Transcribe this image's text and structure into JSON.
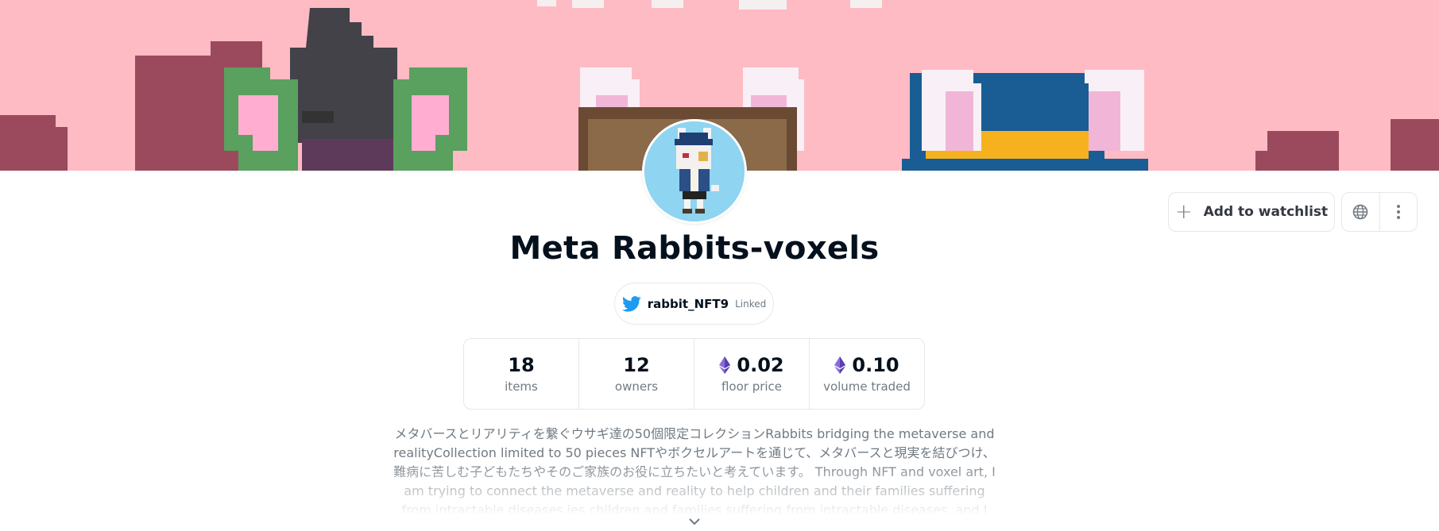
{
  "collection": {
    "name": "Meta Rabbits-voxels",
    "twitter_handle": "rabbit_NFT9",
    "twitter_status": "Linked"
  },
  "actions": {
    "watchlist_label": "Add to watchlist",
    "watchlist_icon": "plus-icon",
    "website_icon": "globe-icon",
    "more_icon": "more-vertical-icon"
  },
  "stats": [
    {
      "value": "18",
      "label": "items",
      "eth": false
    },
    {
      "value": "12",
      "label": "owners",
      "eth": false
    },
    {
      "value": "0.02",
      "label": "floor price",
      "eth": true
    },
    {
      "value": "0.10",
      "label": "volume traded",
      "eth": true
    }
  ],
  "description": {
    "line1": "メタバースとリアリティを繋ぐウサギ達の50個限定コレクションRabbits bridging the metaverse and",
    "line2": "realityCollection limited to 50 pieces NFTやボクセルアートを通じて、メタバースと現実を結びつけ、",
    "line3": "難病に苦しむ子どもたちやそのご家族のお役に立ちたいと考えています。 Through NFT and voxel art, I",
    "line4": "am trying to connect the metaverse and reality to help children and their families suffering",
    "line5": "from intractable diseases.ies children and families suffering from intractable diseases, and I"
  },
  "colors": {
    "banner": "#ffbbc4",
    "title": "#04111d",
    "muted": "#707a83",
    "twitter": "#1d9bf0",
    "eth": "#8a6cd9",
    "border": "#e5e8eb"
  }
}
